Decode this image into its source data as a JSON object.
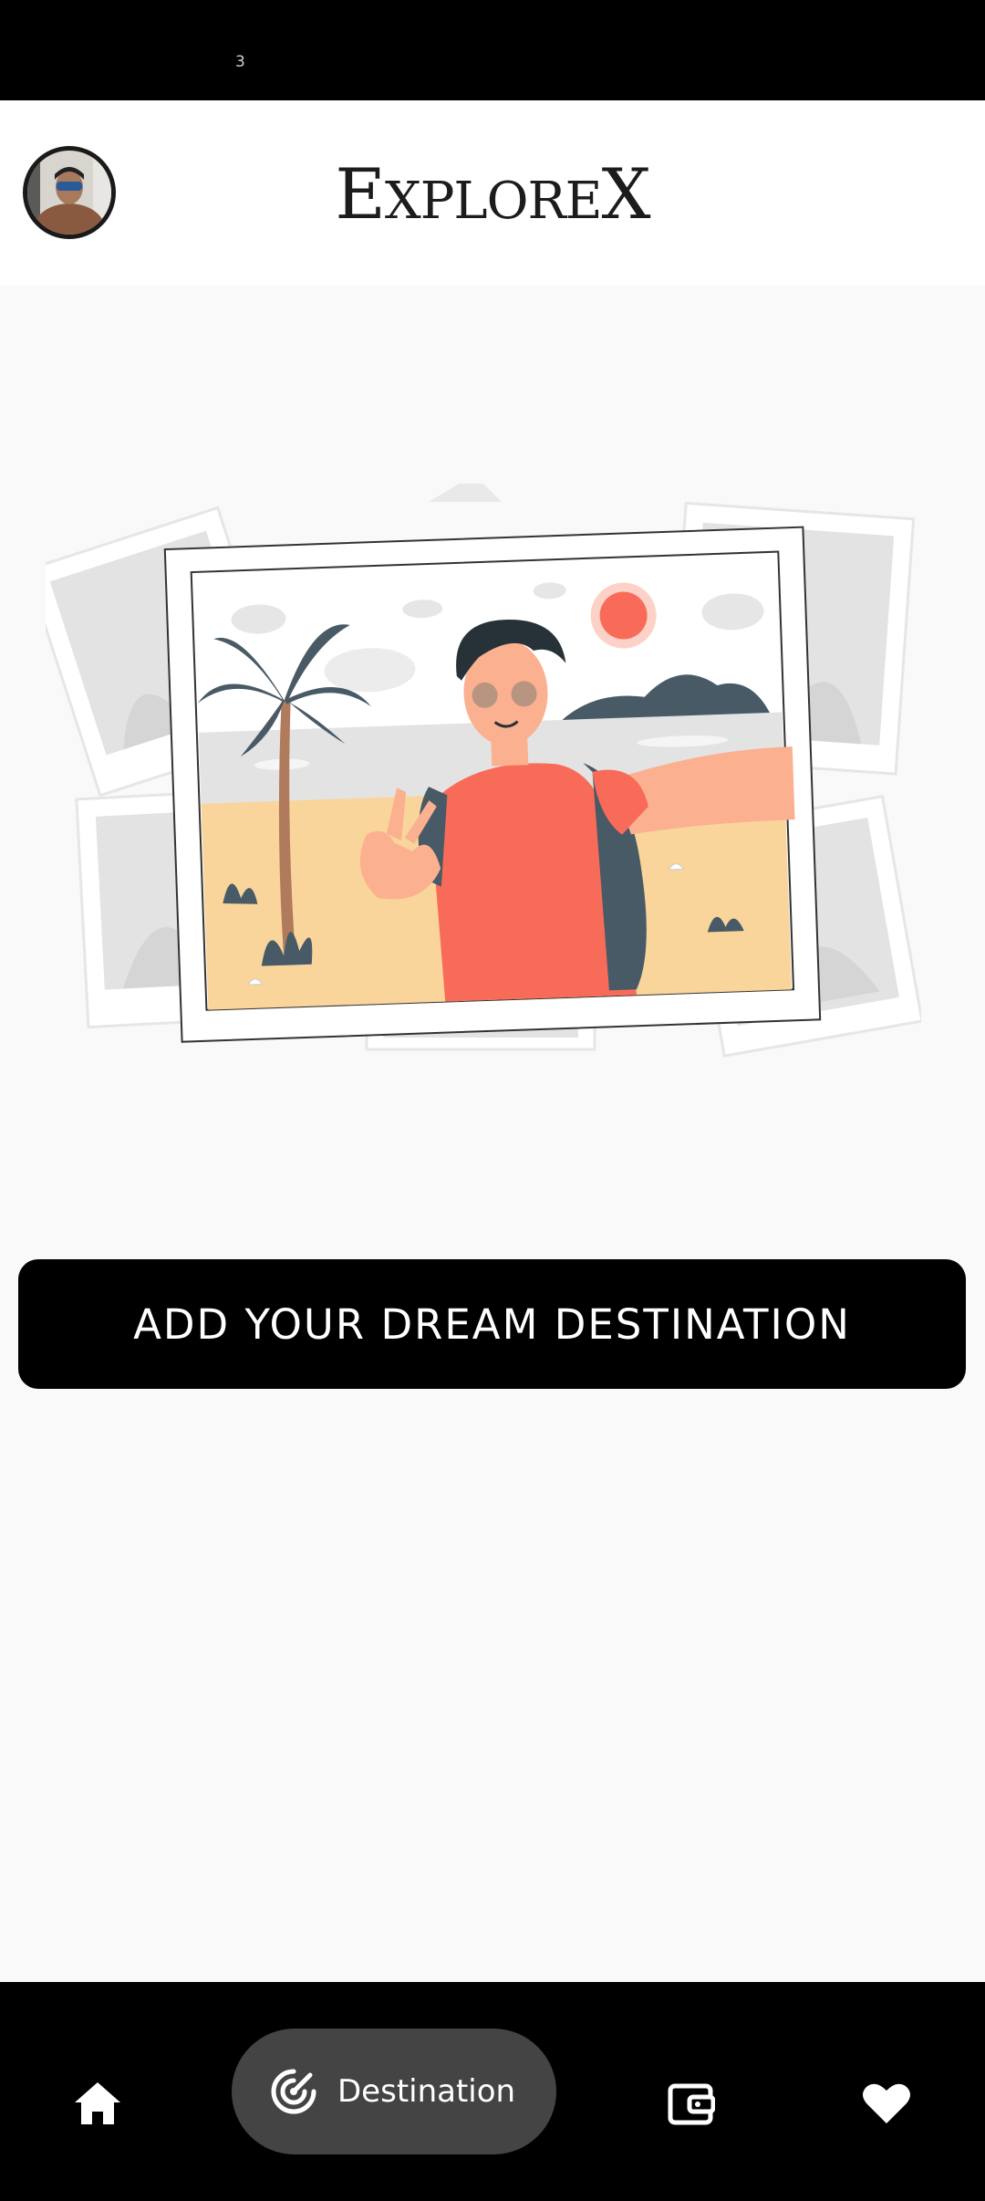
{
  "status_bar": {
    "text": "3"
  },
  "header": {
    "title_parts": [
      "E",
      "XPLORE",
      "X"
    ],
    "avatar_icon": "avatar"
  },
  "illustration": {
    "icon": "travel-selfie-illustration"
  },
  "cta": {
    "label": "ADD YOUR DREAM DESTINATION"
  },
  "bottom_nav": {
    "items": [
      {
        "icon": "home-icon",
        "label": ""
      },
      {
        "icon": "radar-target-icon",
        "label": "Destination",
        "active": true
      },
      {
        "icon": "wallet-icon",
        "label": ""
      },
      {
        "icon": "heart-icon",
        "label": ""
      }
    ]
  },
  "colors": {
    "background": "#f9f9f9",
    "header": "#ffffff",
    "nav": "#000000",
    "active_pill": "#444444",
    "accent_shirt": "#f96b59",
    "sand": "#f9d59b",
    "sun": "#f96b59"
  }
}
